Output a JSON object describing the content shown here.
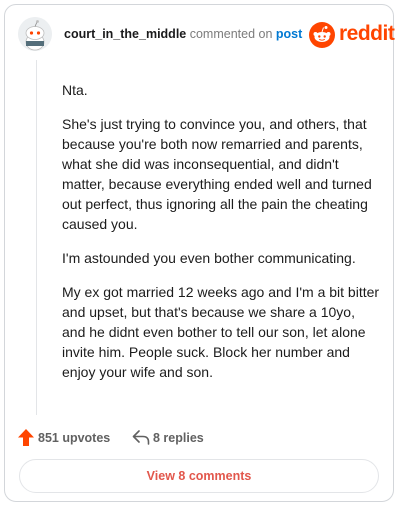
{
  "header": {
    "username": "court_in_the_middle",
    "commented_text": "commented on",
    "post_link": "post",
    "brand": "reddit"
  },
  "comment": {
    "paragraphs": [
      "Nta.",
      "She's just trying to convince you, and others, that because you're both now remarried and parents, what she did was inconsequential, and didn't matter, because everything ended well and turned out perfect, thus ignoring all the pain the cheating caused you.",
      "I'm astounded you even bother communicating.",
      "My ex got married 12 weeks ago and I'm a bit bitter and upset, but that's because we share a 10yo, and he didnt even bother to tell our son, let alone invite him. People suck. Block her number and enjoy your wife and son."
    ]
  },
  "actions": {
    "upvotes": "851 upvotes",
    "replies": "8 replies"
  },
  "view_comments": "View 8 comments",
  "colors": {
    "brand": "#ff4500",
    "link": "#0079d3",
    "upvote_arrow": "#ff4500",
    "view_button_text": "#e2574c"
  },
  "icons": {
    "avatar": "snoo-avatar-icon",
    "brand": "reddit-logo-icon",
    "upvote": "upvote-arrow-icon",
    "reply": "reply-arrow-icon"
  }
}
